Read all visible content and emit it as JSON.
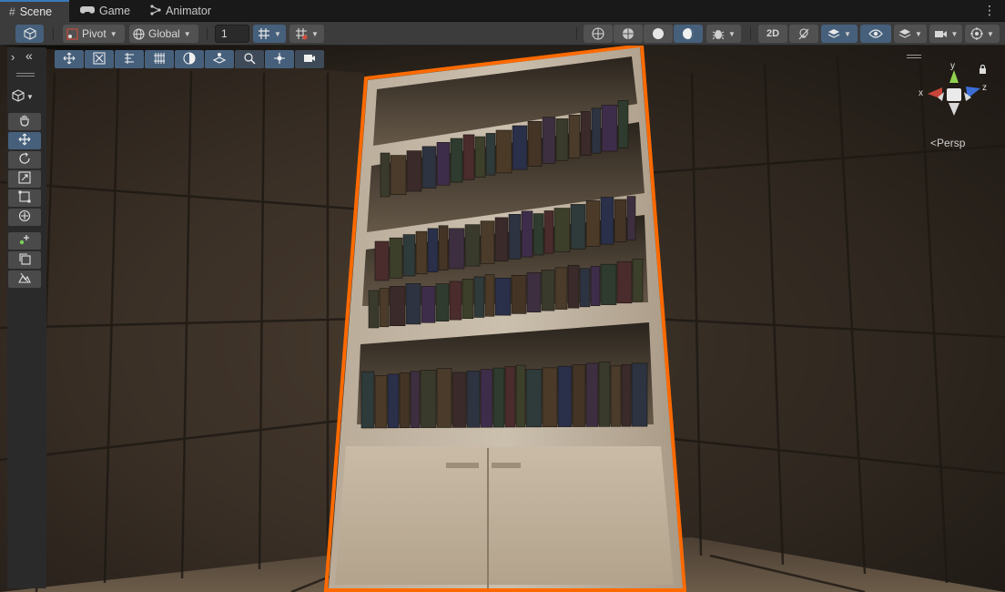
{
  "tabs": [
    {
      "label": "Scene",
      "icon": "grid-icon",
      "active": true
    },
    {
      "label": "Game",
      "icon": "gamepad-icon",
      "active": false
    },
    {
      "label": "Animator",
      "icon": "animator-icon",
      "active": false
    }
  ],
  "toolbar": {
    "pivot_label": "Pivot",
    "global_label": "Global",
    "grid_size_value": "1"
  },
  "gizmo": {
    "y_label": "y",
    "x_label": "x",
    "z_label": "z",
    "projection_label": "Persp"
  },
  "colors": {
    "accent": "#46607c",
    "selection_outline": "#ff6a00",
    "axis_x": "#c8453a",
    "axis_y": "#8fd14f",
    "axis_z": "#3b6fd6"
  }
}
